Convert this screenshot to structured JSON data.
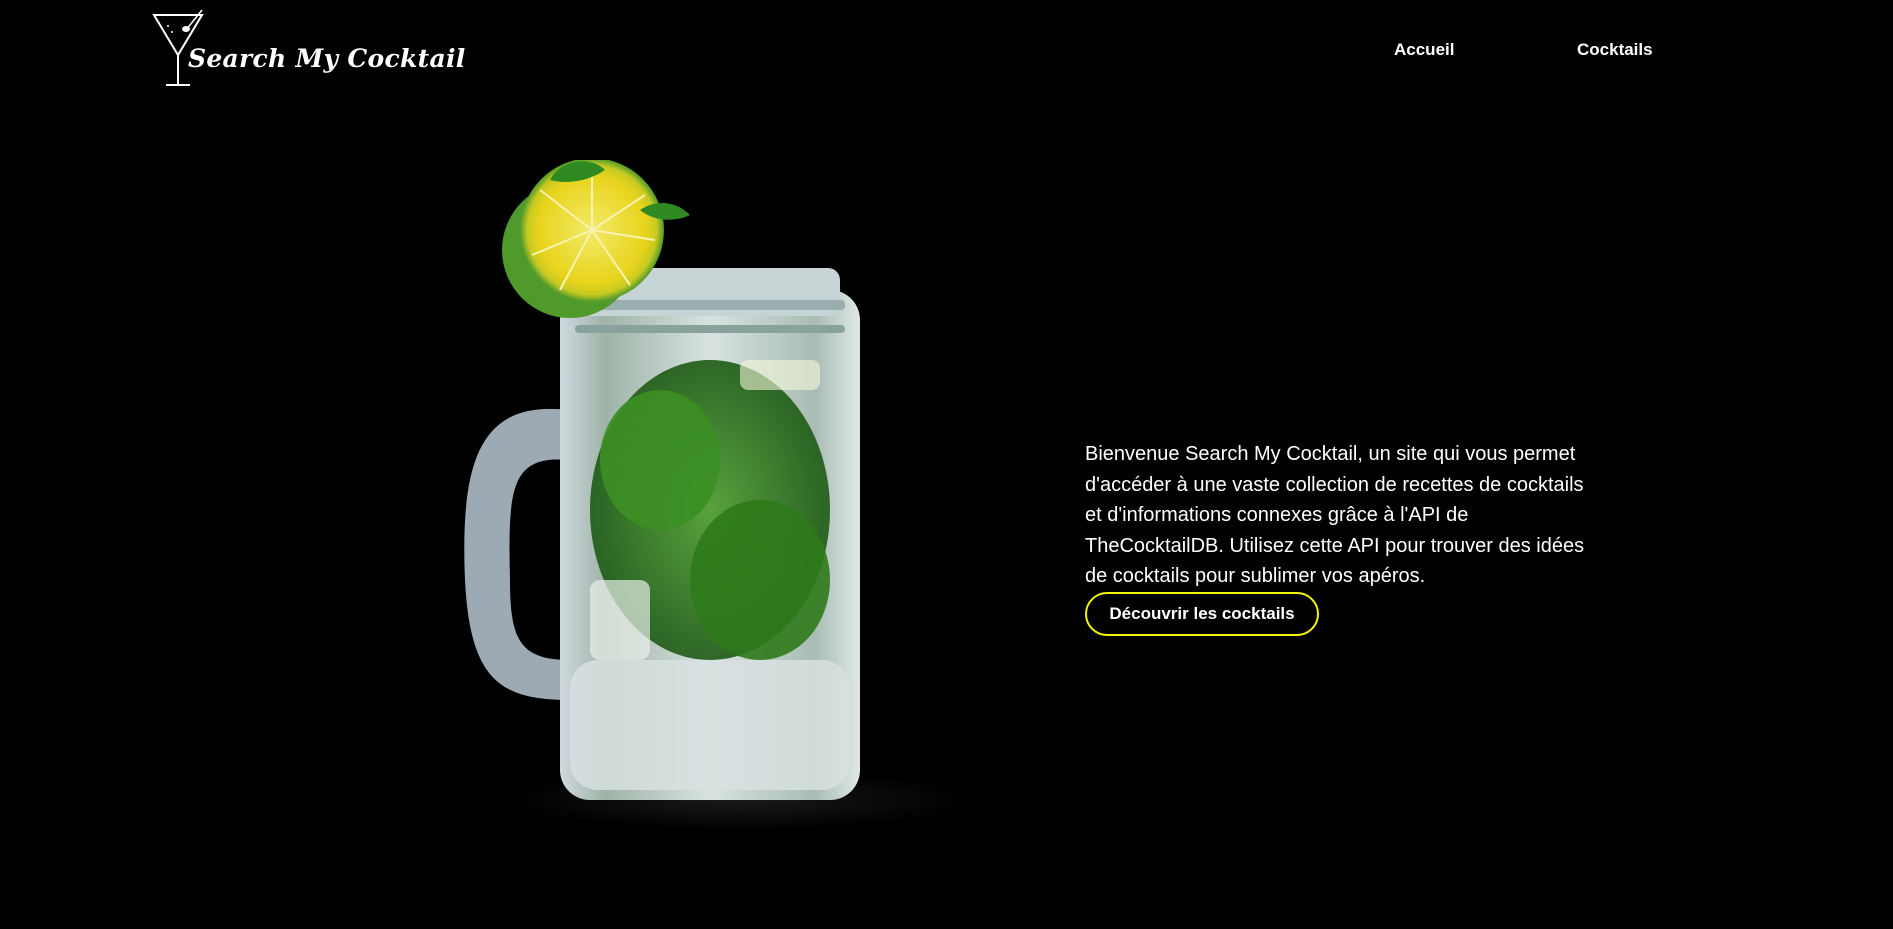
{
  "brand": {
    "name": "Search My Cocktail",
    "logo_icon": "martini-glass-icon"
  },
  "nav": {
    "home_label": "Accueil",
    "cocktails_label": "Cocktails"
  },
  "hero": {
    "image_icon": "mojito-mason-jar-image",
    "intro_text": "Bienvenue Search My Cocktail, un site qui vous permet d'accéder à une vaste collection de recettes de cocktails et d'informations connexes grâce à l'API de TheCocktailDB. Utilisez cette API pour trouver des idées de cocktails pour sublimer vos apéros.",
    "cta_label": "Découvrir les cocktails"
  },
  "colors": {
    "background": "#000000",
    "text": "#ffffff",
    "accent": "#f2f20a"
  }
}
